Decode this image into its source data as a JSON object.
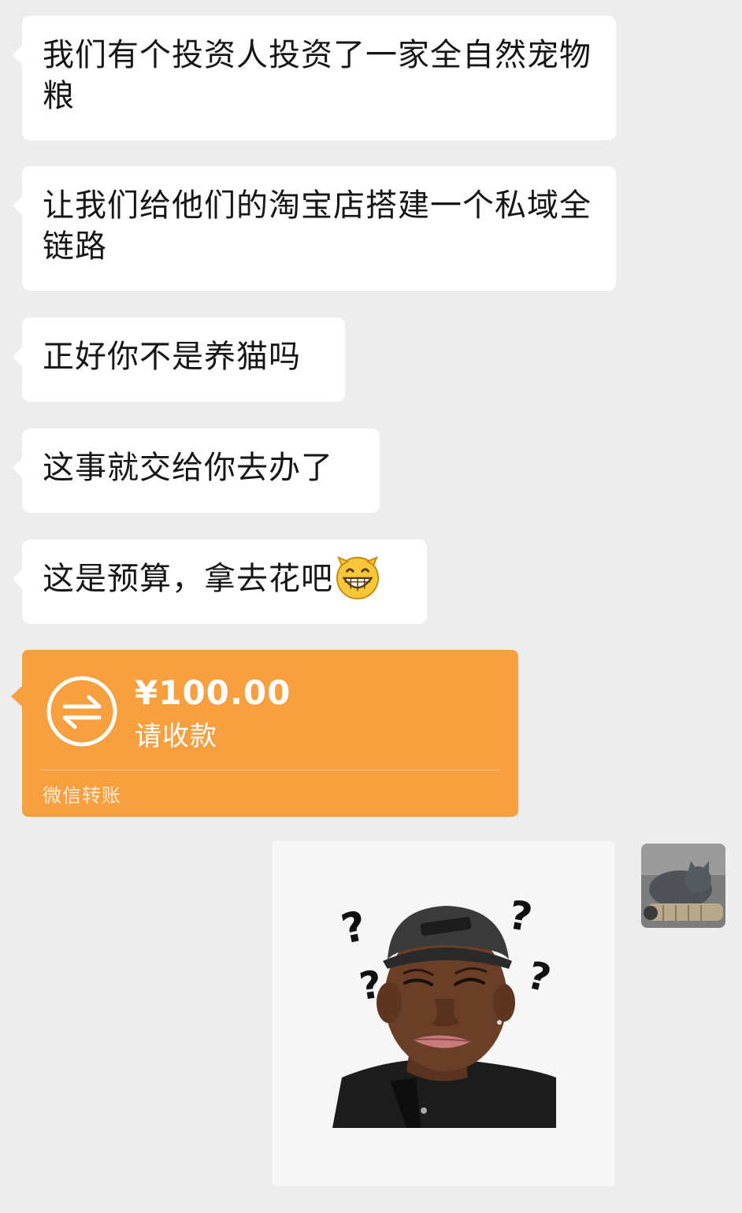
{
  "messages": [
    {
      "text": "我们有个投资人投资了一家全自然宠物粮"
    },
    {
      "text": "让我们给他们的淘宝店搭建一个私域全链路"
    },
    {
      "text": "正好你不是养猫吗"
    },
    {
      "text": "这事就交给你去办了"
    },
    {
      "text": "这是预算，拿去花吧",
      "emoji": "grinning-face-emoji"
    }
  ],
  "transfer": {
    "amount": "¥100.00",
    "status": "请收款",
    "footer": "微信转账",
    "icon": "transfer-arrows-icon",
    "color": "#f8a03f"
  },
  "reply": {
    "sticker": "confused-man-question-marks-sticker",
    "avatar": "cat-avatar"
  },
  "colors": {
    "background": "#ededed",
    "bubble": "#ffffff",
    "text": "#161616"
  }
}
